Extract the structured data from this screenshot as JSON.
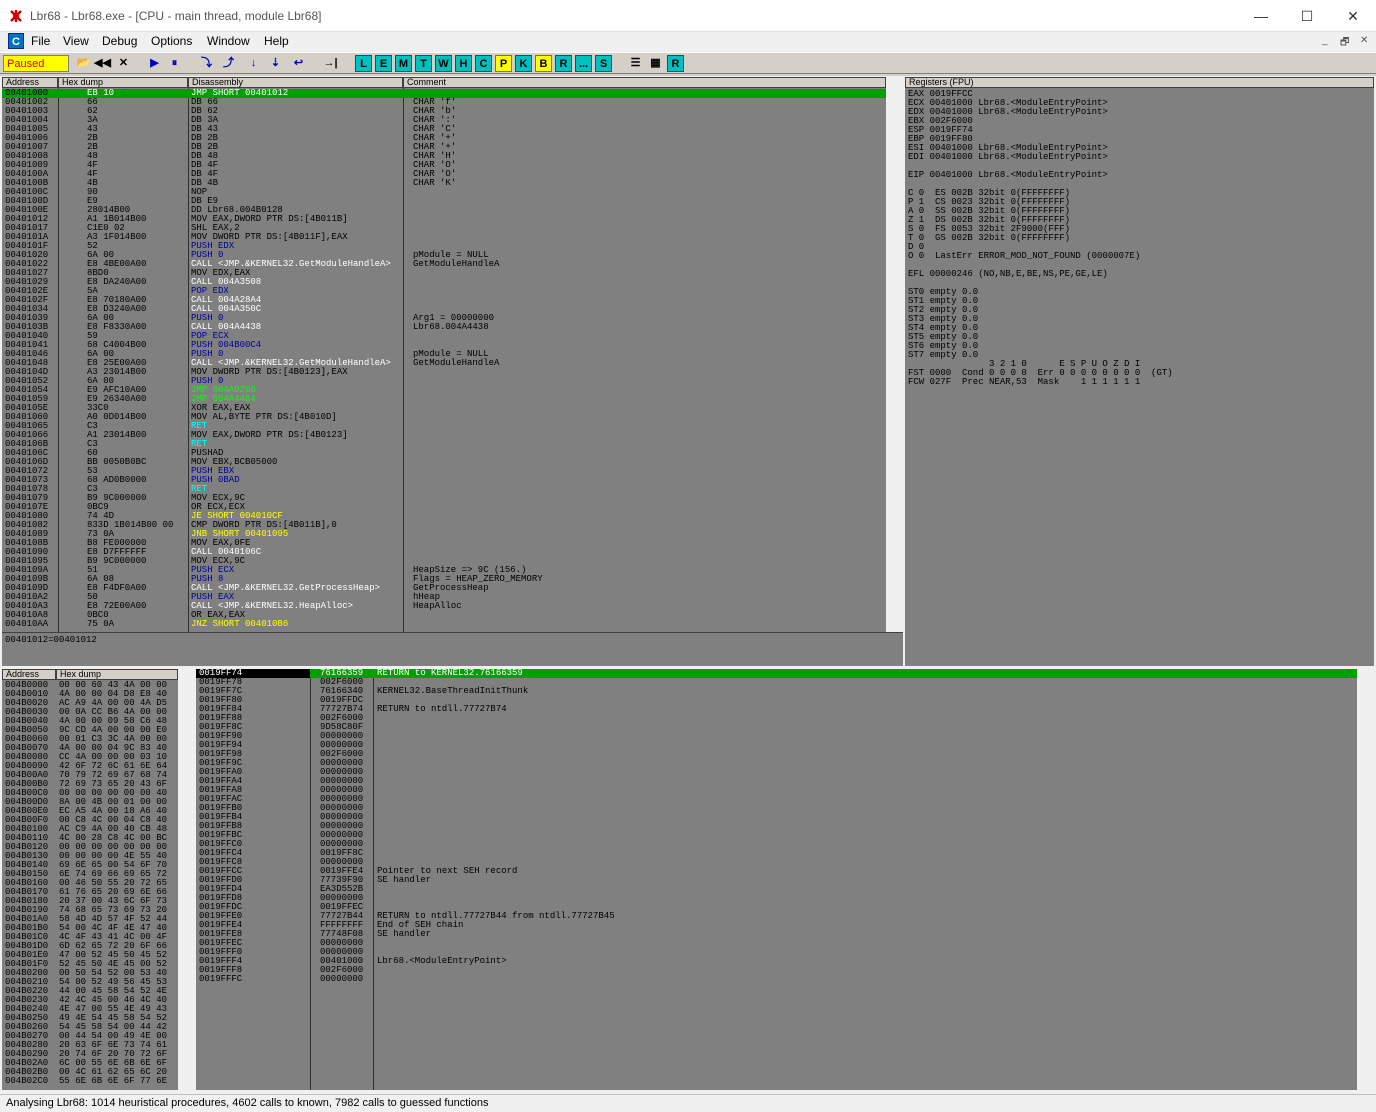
{
  "window": {
    "title": "Lbr68 - Lbr68.exe - [CPU - main thread, module Lbr68]",
    "minimize": "—",
    "maximize": "☐",
    "close": "✕"
  },
  "menu": [
    "File",
    "View",
    "Debug",
    "Options",
    "Window",
    "Help"
  ],
  "menu_icon": "C",
  "mdi": [
    "_",
    "🗗",
    "✕"
  ],
  "toolbar": {
    "status": "Paused",
    "buttons": [
      "📂",
      "◀◀",
      "✕",
      "▶",
      "⏸",
      "⤵",
      "⤴",
      "↓",
      "⇣",
      "↩",
      "→|"
    ],
    "letters": [
      "L",
      "E",
      "M",
      "T",
      "W",
      "H",
      "C",
      "P",
      "K",
      "B",
      "R",
      "...",
      "S"
    ],
    "end": [
      "☰",
      "▦",
      "R"
    ]
  },
  "disasm": {
    "headers": [
      "Address",
      "Hex dump",
      "Disassembly",
      "Comment"
    ],
    "rows": [
      [
        "00401000",
        "EB 10",
        "JMP SHORT 00401012",
        "",
        1,
        "w"
      ],
      [
        "00401002",
        "66",
        "DB 66",
        "CHAR 'f'",
        0,
        "g"
      ],
      [
        "00401003",
        "62",
        "DB 62",
        "CHAR 'b'",
        0,
        "g"
      ],
      [
        "00401004",
        "3A",
        "DB 3A",
        "CHAR ':'",
        0,
        "g"
      ],
      [
        "00401005",
        "43",
        "DB 43",
        "CHAR 'C'",
        0,
        "g"
      ],
      [
        "00401006",
        "2B",
        "DB 2B",
        "CHAR '+'",
        0,
        "g"
      ],
      [
        "00401007",
        "2B",
        "DB 2B",
        "CHAR '+'",
        0,
        "g"
      ],
      [
        "00401008",
        "48",
        "DB 48",
        "CHAR 'H'",
        0,
        "g"
      ],
      [
        "00401009",
        "4F",
        "DB 4F",
        "CHAR 'O'",
        0,
        "g"
      ],
      [
        "0040100A",
        "4F",
        "DB 4F",
        "CHAR 'O'",
        0,
        "g"
      ],
      [
        "0040100B",
        "4B",
        "DB 4B",
        "CHAR 'K'",
        0,
        "g"
      ],
      [
        "0040100C",
        "90",
        "NOP",
        "",
        0,
        "g"
      ],
      [
        "0040100D",
        "E9",
        "DB E9",
        "",
        0,
        "g"
      ],
      [
        "0040100E",
        "28014B00",
        "DD Lbr68.004B0128",
        "",
        0,
        ""
      ],
      [
        "00401012",
        "A1 1B014B00",
        "MOV EAX,DWORD PTR DS:[4B011B]",
        "",
        0,
        ""
      ],
      [
        "00401017",
        "C1E0 02",
        "SHL EAX,2",
        "",
        0,
        ""
      ],
      [
        "0040101A",
        "A3 1F014B00",
        "MOV DWORD PTR DS:[4B011F],EAX",
        "",
        0,
        ""
      ],
      [
        "0040101F",
        "52",
        "PUSH EDX",
        "",
        0,
        "b"
      ],
      [
        "00401020",
        "6A 00",
        "PUSH 0",
        "pModule = NULL",
        0,
        "b"
      ],
      [
        "00401022",
        "E8 4BE00A00",
        "CALL <JMP.&KERNEL32.GetModuleHandleA>",
        "GetModuleHandleA",
        0,
        "w"
      ],
      [
        "00401027",
        "8BD0",
        "MOV EDX,EAX",
        "",
        0,
        ""
      ],
      [
        "00401029",
        "E8 DA240A00",
        "CALL 004A3508",
        "",
        0,
        "w"
      ],
      [
        "0040102E",
        "5A",
        "POP EDX",
        "",
        0,
        "b"
      ],
      [
        "0040102F",
        "E8 70180A00",
        "CALL 004A28A4",
        "",
        0,
        "w"
      ],
      [
        "00401034",
        "E8 D3240A00",
        "CALL 004A350C",
        "",
        0,
        "w"
      ],
      [
        "00401039",
        "6A 00",
        "PUSH 0",
        "Arg1 = 00000000",
        0,
        "b"
      ],
      [
        "0040103B",
        "E8 F8330A00",
        "CALL 004A4438",
        "Lbr68.004A4438",
        0,
        "w"
      ],
      [
        "00401040",
        "59",
        "POP ECX",
        "",
        0,
        "b"
      ],
      [
        "00401041",
        "68 C4004B00",
        "PUSH 004B00C4",
        "",
        0,
        "b"
      ],
      [
        "00401046",
        "6A 00",
        "PUSH 0",
        "pModule = NULL",
        0,
        "b"
      ],
      [
        "00401048",
        "E8 25E00A00",
        "CALL <JMP.&KERNEL32.GetModuleHandleA>",
        "GetModuleHandleA",
        0,
        "w"
      ],
      [
        "0040104D",
        "A3 23014B00",
        "MOV DWORD PTR DS:[4B0123],EAX",
        "",
        0,
        ""
      ],
      [
        "00401052",
        "6A 00",
        "PUSH 0",
        "",
        0,
        "b"
      ],
      [
        "00401054",
        "E9 AFC10A00",
        "JMP 004AD208",
        "",
        0,
        "gr"
      ],
      [
        "00401059",
        "E9 26340A00",
        "JMP 004A4484",
        "",
        0,
        "gr"
      ],
      [
        "0040105E",
        "33C0",
        "XOR EAX,EAX",
        "",
        0,
        ""
      ],
      [
        "00401060",
        "A0 0D014B00",
        "MOV AL,BYTE PTR DS:[4B010D]",
        "",
        0,
        ""
      ],
      [
        "00401065",
        "C3",
        "RET",
        "",
        0,
        "c"
      ],
      [
        "00401066",
        "A1 23014B00",
        "MOV EAX,DWORD PTR DS:[4B0123]",
        "",
        0,
        ""
      ],
      [
        "0040106B",
        "C3",
        "RET",
        "",
        0,
        "c"
      ],
      [
        "0040106C",
        "60",
        "PUSHAD",
        "",
        0,
        ""
      ],
      [
        "0040106D",
        "BB 0050B0BC",
        "MOV EBX,BCB05000",
        "",
        0,
        ""
      ],
      [
        "00401072",
        "53",
        "PUSH EBX",
        "",
        0,
        "b"
      ],
      [
        "00401073",
        "68 AD0B0000",
        "PUSH 0BAD",
        "",
        0,
        "b"
      ],
      [
        "00401078",
        "C3",
        "RET",
        "",
        0,
        "c"
      ],
      [
        "00401079",
        "B9 9C000000",
        "MOV ECX,9C",
        "",
        0,
        ""
      ],
      [
        "0040107E",
        "0BC9",
        "OR ECX,ECX",
        "",
        0,
        ""
      ],
      [
        "00401080",
        "74 4D",
        "JE SHORT 004010CF",
        "",
        0,
        "y"
      ],
      [
        "00401082",
        "833D 1B014B00 00",
        "CMP DWORD PTR DS:[4B011B],0",
        "",
        0,
        ""
      ],
      [
        "00401089",
        "73 0A",
        "JNB SHORT 00401095",
        "",
        0,
        "y"
      ],
      [
        "0040108B",
        "B8 FE000000",
        "MOV EAX,0FE",
        "",
        0,
        ""
      ],
      [
        "00401090",
        "E8 D7FFFFFF",
        "CALL 0040106C",
        "",
        0,
        "w"
      ],
      [
        "00401095",
        "B9 9C000000",
        "MOV ECX,9C",
        "",
        0,
        ""
      ],
      [
        "0040109A",
        "51",
        "PUSH ECX",
        "HeapSize => 9C (156.)",
        0,
        "b"
      ],
      [
        "0040109B",
        "6A 08",
        "PUSH 8",
        "Flags = HEAP_ZERO_MEMORY",
        0,
        "b"
      ],
      [
        "0040109D",
        "E8 F4DF0A00",
        "CALL <JMP.&KERNEL32.GetProcessHeap>",
        "GetProcessHeap",
        0,
        "w"
      ],
      [
        "004010A2",
        "50",
        "PUSH EAX",
        "hHeap",
        0,
        "b"
      ],
      [
        "004010A3",
        "E8 72E00A00",
        "CALL <JMP.&KERNEL32.HeapAlloc>",
        "HeapAlloc",
        0,
        "w"
      ],
      [
        "004010A8",
        "0BC0",
        "OR EAX,EAX",
        "",
        0,
        ""
      ],
      [
        "004010AA",
        "75 0A",
        "JNZ SHORT 004010B6",
        "",
        0,
        "y"
      ]
    ],
    "info": "00401012=00401012"
  },
  "registers": {
    "header": "Registers (FPU)",
    "lines": [
      "EAX 0019FFCC",
      "ECX 00401000 Lbr68.<ModuleEntryPoint>",
      "EDX 00401000 Lbr68.<ModuleEntryPoint>",
      "EBX 002F6000",
      "ESP 0019FF74",
      "EBP 0019FF80",
      "ESI 00401000 Lbr68.<ModuleEntryPoint>",
      "EDI 00401000 Lbr68.<ModuleEntryPoint>",
      "",
      "EIP 00401000 Lbr68.<ModuleEntryPoint>",
      "",
      "C 0  ES 002B 32bit 0(FFFFFFFF)",
      "P 1  CS 0023 32bit 0(FFFFFFFF)",
      "A 0  SS 002B 32bit 0(FFFFFFFF)",
      "Z 1  DS 002B 32bit 0(FFFFFFFF)",
      "S 0  FS 0053 32bit 2F9000(FFF)",
      "T 0  GS 002B 32bit 0(FFFFFFFF)",
      "D 0",
      "O 0  LastErr ERROR_MOD_NOT_FOUND (0000007E)",
      "",
      "EFL 00000246 (NO,NB,E,BE,NS,PE,GE,LE)",
      "",
      "ST0 empty 0.0",
      "ST1 empty 0.0",
      "ST2 empty 0.0",
      "ST3 empty 0.0",
      "ST4 empty 0.0",
      "ST5 empty 0.0",
      "ST6 empty 0.0",
      "ST7 empty 0.0",
      "               3 2 1 0      E S P U O Z D I",
      "FST 0000  Cond 0 0 0 0  Err 0 0 0 0 0 0 0 0  (GT)",
      "FCW 027F  Prec NEAR,53  Mask    1 1 1 1 1 1"
    ]
  },
  "dump": {
    "headers": [
      "Address",
      "Hex dump"
    ],
    "rows": [
      [
        "004B0000",
        "00 00 60 43 4A 00 00"
      ],
      [
        "004B0010",
        "4A 00 00 04 D8 E8 40"
      ],
      [
        "004B0020",
        "AC A9 4A 00 00 4A D5"
      ],
      [
        "004B0030",
        "00 0A CC B6 4A 00 00"
      ],
      [
        "004B0040",
        "4A 00 00 09 58 C6 48"
      ],
      [
        "004B0050",
        "9C CD 4A 00 00 00 E0"
      ],
      [
        "004B0060",
        "00 01 C3 3C 4A 00 00"
      ],
      [
        "004B0070",
        "4A 00 00 04 9C 83 40"
      ],
      [
        "004B0080",
        "CC 4A 00 00 00 03 10"
      ],
      [
        "004B0090",
        "42 6F 72 6C 61 6E 64"
      ],
      [
        "004B00A0",
        "70 79 72 69 67 68 74"
      ],
      [
        "004B00B0",
        "72 69 73 65 20 43 6F"
      ],
      [
        "004B00C0",
        "00 00 00 00 00 00 40"
      ],
      [
        "004B00D0",
        "8A 00 4B 00 01 00 00"
      ],
      [
        "004B00E0",
        "EC A5 4A 00 18 A6 40"
      ],
      [
        "004B00F0",
        "00 C8 4C 00 04 C8 40"
      ],
      [
        "004B0100",
        "AC C9 4A 00 40 CB 48"
      ],
      [
        "004B0110",
        "4C 00 28 C8 4C 00 BC"
      ],
      [
        "004B0120",
        "00 00 00 00 00 00 00"
      ],
      [
        "004B0130",
        "00 00 00 00 4E 55 40"
      ],
      [
        "004B0140",
        "69 6E 65 00 54 6F 70"
      ],
      [
        "004B0150",
        "6E 74 69 66 69 65 72"
      ],
      [
        "004B0160",
        "00 46 50 55 20 72 65"
      ],
      [
        "004B0170",
        "61 76 65 20 69 6E 66"
      ],
      [
        "004B0180",
        "20 37 00 43 6C 6F 73"
      ],
      [
        "004B0190",
        "74 68 65 73 69 73 20"
      ],
      [
        "004B01A0",
        "58 4D 4D 57 4F 52 44"
      ],
      [
        "004B01B0",
        "54 00 4C 4F 4E 47 40"
      ],
      [
        "004B01C0",
        "4C 4F 43 41 4C 00 4F"
      ],
      [
        "004B01D0",
        "6D 62 65 72 20 6F 66"
      ],
      [
        "004B01E0",
        "47 00 52 45 50 45 52"
      ],
      [
        "004B01F0",
        "52 45 50 4E 45 00 52"
      ],
      [
        "004B0200",
        "00 50 54 52 00 53 40"
      ],
      [
        "004B0210",
        "54 00 52 49 56 45 53"
      ],
      [
        "004B0220",
        "44 00 45 58 54 52 4E"
      ],
      [
        "004B0230",
        "42 4C 45 00 46 4C 40"
      ],
      [
        "004B0240",
        "4E 47 00 55 4E 49 43"
      ],
      [
        "004B0250",
        "49 4E 54 45 58 54 52"
      ],
      [
        "004B0260",
        "54 45 58 54 00 44 42"
      ],
      [
        "004B0270",
        "00 44 54 00 49 4E 00"
      ],
      [
        "004B0280",
        "20 63 6F 6E 73 74 61"
      ],
      [
        "004B0290",
        "20 74 6F 20 70 72 6F"
      ],
      [
        "004B02A0",
        "6C 00 55 6E 6B 6E 6F"
      ],
      [
        "004B02B0",
        "00 4C 61 62 65 6C 20"
      ],
      [
        "004B02C0",
        "55 6E 6B 6E 6F 77 6E"
      ]
    ]
  },
  "stack": {
    "rows": [
      [
        "0019FF74",
        "76166359",
        "RETURN to KERNEL32.76166359",
        1
      ],
      [
        "0019FF78",
        "002F6000",
        "",
        0
      ],
      [
        "0019FF7C",
        "76166340",
        "KERNEL32.BaseThreadInitThunk",
        0
      ],
      [
        "0019FF80",
        "0019FFDC",
        "",
        0
      ],
      [
        "0019FF84",
        "77727B74",
        "RETURN to ntdll.77727B74",
        0
      ],
      [
        "0019FF88",
        "002F6000",
        "",
        0
      ],
      [
        "0019FF8C",
        "9D58C80F",
        "",
        0
      ],
      [
        "0019FF90",
        "00000000",
        "",
        0
      ],
      [
        "0019FF94",
        "00000000",
        "",
        0
      ],
      [
        "0019FF98",
        "002F6000",
        "",
        0
      ],
      [
        "0019FF9C",
        "00000000",
        "",
        0
      ],
      [
        "0019FFA0",
        "00000000",
        "",
        0
      ],
      [
        "0019FFA4",
        "00000000",
        "",
        0
      ],
      [
        "0019FFA8",
        "00000000",
        "",
        0
      ],
      [
        "0019FFAC",
        "00000000",
        "",
        0
      ],
      [
        "0019FFB0",
        "00000000",
        "",
        0
      ],
      [
        "0019FFB4",
        "00000000",
        "",
        0
      ],
      [
        "0019FFB8",
        "00000000",
        "",
        0
      ],
      [
        "0019FFBC",
        "00000000",
        "",
        0
      ],
      [
        "0019FFC0",
        "00000000",
        "",
        0
      ],
      [
        "0019FFC4",
        "0019FF8C",
        "",
        0
      ],
      [
        "0019FFC8",
        "00000000",
        "",
        0
      ],
      [
        "0019FFCC",
        "0019FFE4",
        "Pointer to next SEH record",
        0
      ],
      [
        "0019FFD0",
        "77739F90",
        "SE handler",
        0
      ],
      [
        "0019FFD4",
        "EA3D552B",
        "",
        0
      ],
      [
        "0019FFD8",
        "00000000",
        "",
        0
      ],
      [
        "0019FFDC",
        "0019FFEC",
        "",
        0
      ],
      [
        "0019FFE0",
        "77727B44",
        "RETURN to ntdll.77727B44 from ntdll.77727B45",
        0
      ],
      [
        "0019FFE4",
        "FFFFFFFF",
        "End of SEH chain",
        0
      ],
      [
        "0019FFE8",
        "77748F08",
        "SE handler",
        0
      ],
      [
        "0019FFEC",
        "00000000",
        "",
        0
      ],
      [
        "0019FFF0",
        "00000000",
        "",
        0
      ],
      [
        "0019FFF4",
        "00401000",
        "Lbr68.<ModuleEntryPoint>",
        0
      ],
      [
        "0019FFF8",
        "002F6000",
        "",
        0
      ],
      [
        "0019FFFC",
        "00000000",
        "",
        0
      ]
    ]
  },
  "statusbar": "Analysing Lbr68: 1014 heuristical procedures, 4602 calls to known, 7982 calls to guessed functions",
  "colors": {
    "pane": "#808080",
    "selection": "#00a000",
    "paused_bg": "#ffff00",
    "paused_fg": "#e00000"
  }
}
